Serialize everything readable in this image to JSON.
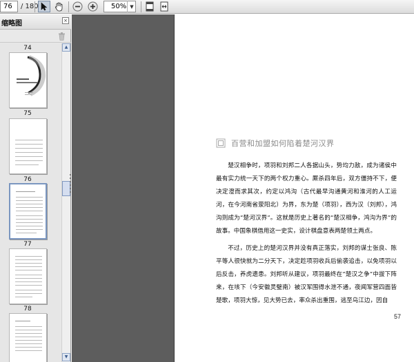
{
  "toolbar": {
    "current_page": "76",
    "page_total": "/ 180",
    "zoom": "50%",
    "zoom_caret": "▼"
  },
  "sidebar": {
    "title": "缩略图",
    "close_glyph": "×",
    "thumbnails": [
      {
        "label": "74"
      },
      {
        "label": "75"
      },
      {
        "label": "76"
      },
      {
        "label": "77"
      },
      {
        "label": "78"
      }
    ],
    "scroll_up": "▲",
    "scroll_down": "▼"
  },
  "document": {
    "title": "百营和加盟如何陷着楚河汉界",
    "paragraphs": [
      "楚汉相争时，项羽和刘邦二人各据山头，势均力敌，成为诸侯中最有实力统一天下的两个权力重心。厮杀四年后，双方僵持不下，便决定澄而求其次，约定以鸿沟（古代最早沟通黄河和淮河的人工运河，在今河南省荥阳北）为界，东为楚（项羽），西为汉（刘邦），鸿沟则成为“楚河汉界”。这就是历史上著名的“楚汉相争，鸿沟为界”的故事。中国象棋借用这一史实，设计棋盘意表两楚领土两点。",
      "不过，历史上的楚河汉界并没有真正落实，刘邦的谋士张良、陈平等人很快就为二分天下，决定趁项羽收兵后偷袭追击，以免项羽以后反击，养虎遗患。刘邦听从建议，项羽最终在“楚汉之争”中拔下阵来，在垓下（今安徽灵璧南）被汉军围得水泄不通，夜闻军营四面皆楚歌，项羽大惊，见大势已去，率众杀出重围，逃至乌江边，因自"
    ],
    "page_number": "57"
  }
}
